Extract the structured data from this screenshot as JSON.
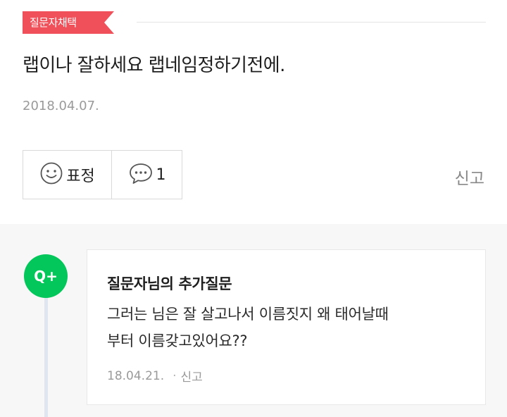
{
  "answer": {
    "badge": "질문자채택",
    "text": "랩이나 잘하세요 랩네임정하기전에.",
    "date": "2018.04.07.",
    "actions": {
      "reaction_label": "표정",
      "comment_count": "1"
    },
    "report": "신고"
  },
  "followup": {
    "icon_label": "Q+",
    "title": "질문자님의 추가질문",
    "body_line1": "그러는 님은 잘 살고나서 이름짓지 왜 태어날때",
    "body_line2": "부터 이름갖고있어요??",
    "date": "18.04.21.",
    "separator": "·",
    "report": "신고"
  },
  "colors": {
    "badge": "#f0505a",
    "qplus": "#03c75a"
  }
}
